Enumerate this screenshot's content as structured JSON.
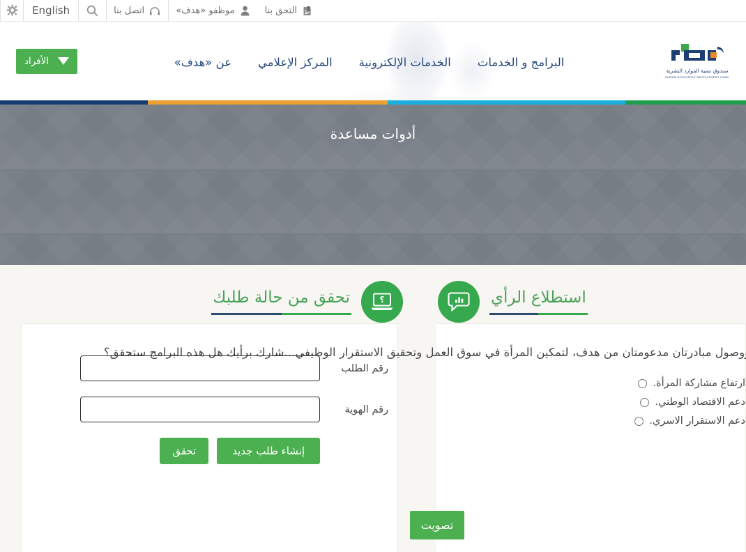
{
  "topbar": {
    "items": [
      {
        "label": "التحق بنا",
        "icon": "register-icon"
      },
      {
        "label": "موظفو «هدف»",
        "icon": "user-icon"
      },
      {
        "label": "اتصل بنا",
        "icon": "headset-icon"
      },
      {
        "label": "",
        "icon": "search-icon"
      },
      {
        "label": "English",
        "icon": ""
      },
      {
        "label": "",
        "icon": "gear-icon"
      }
    ]
  },
  "header": {
    "logo": {
      "wordmark": "هدف",
      "arabic_name": "صندوق تنمية الموارد البشرية",
      "english_name": "HUMAN RESOURCES DEVELOPMENT FUND"
    },
    "nav": [
      {
        "label": "البرامج و الخدمات"
      },
      {
        "label": "الخدمات الإلكترونية"
      },
      {
        "label": "المركز الإعلامي"
      },
      {
        "label": "عن «هدف»"
      }
    ],
    "persons_button": {
      "label": "الأفراد",
      "icon": "chevron-down-icon"
    }
  },
  "stripe": {
    "colors": [
      "#1f9e4d",
      "#1bafe0",
      "#eda02f",
      "#143c73"
    ],
    "widths": [
      "23%",
      "25%",
      "32%",
      "20%"
    ]
  },
  "hero": {
    "title": "أدوات مساعدة",
    "background_color": "#7e848b",
    "loader": "loading-spinner"
  },
  "panels": {
    "status": {
      "title": "تحقق من حالة طلبك",
      "icon": "laptop-question-icon",
      "accent_color": "#4ba159",
      "fields": [
        {
          "label": "رقم الطلب",
          "value": "",
          "placeholder": "",
          "name": "request-number-field"
        },
        {
          "label": "رقم الهوية",
          "value": "",
          "placeholder": "",
          "name": "id-number-field"
        }
      ],
      "buttons": [
        {
          "label": "تحقق",
          "name": "verify-button"
        },
        {
          "label": "إنشاء طلب جديد",
          "name": "create-new-request-button"
        }
      ]
    },
    "poll": {
      "title": "استطلاع الرأي",
      "icon": "poll-chat-icon",
      "accent_color": "#4ba159",
      "question": "قُرّة ووصول مبادرتان مدعومتان من هدف، لتمكين المرأة في سوق العمل وتحقيق الاستقرار الوظيفي...شارك برأيك هل هذه البرامج ستحقق؟",
      "options": [
        {
          "label": "ارتفاع مشاركة المرأة."
        },
        {
          "label": "دعم الاقتصاد الوطني."
        },
        {
          "label": "دعم الاستقرار الاسري."
        }
      ],
      "vote_button": {
        "label": "تصويت"
      }
    }
  }
}
